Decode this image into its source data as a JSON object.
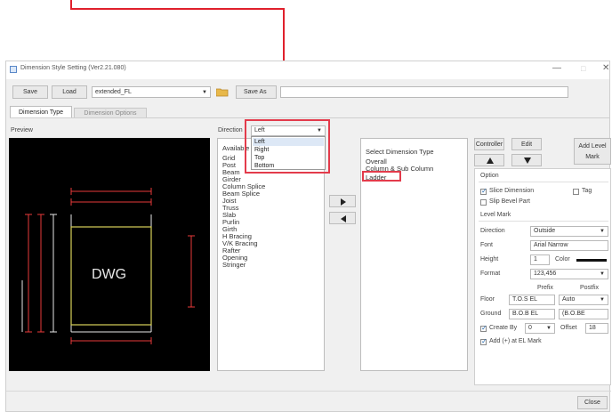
{
  "window": {
    "title": "Dimension Style Setting (Ver2.21.080)",
    "minimize_icon": "minimize-icon",
    "close_icon": "close-icon"
  },
  "toolbar": {
    "save_label": "Save",
    "load_label": "Load",
    "style_value": "extended_FL",
    "folder_icon": "folder-icon",
    "save_as_label": "Save As"
  },
  "tabs": [
    {
      "label": "Dimension Type"
    },
    {
      "label": "Dimension Options"
    }
  ],
  "preview": {
    "label": "Preview",
    "canvas_text": "DWG"
  },
  "direction": {
    "label": "Direction",
    "value": "Left",
    "options": [
      "Left",
      "Right",
      "Top",
      "Bottom"
    ]
  },
  "available": {
    "header": "Available",
    "items": [
      "Grid",
      "Post",
      "Beam",
      "Girder",
      "Column Splice",
      "Beam Splice",
      "Joist",
      "Truss",
      "Slab",
      "Purlin",
      "Girth",
      "H Bracing",
      "V/K Bracing",
      "Rafter",
      "Opening",
      "Stringer"
    ]
  },
  "transfer": {
    "add_icon": "triangle-right-icon",
    "remove_icon": "triangle-left-icon"
  },
  "selected": {
    "header": "Select Dimension Type",
    "items": [
      "Overall",
      "Column & Sub Column",
      "Ladder"
    ]
  },
  "right_panel": {
    "controller_label": "Controller",
    "edit_label": "Edit",
    "add_level_mark_label": "Add Level Mark",
    "up_icon": "triangle-up-icon",
    "down_icon": "triangle-down-icon",
    "option_title": "Option",
    "slice_dimension": {
      "label": "Slice Dimension",
      "checked": true
    },
    "tag": {
      "label": "Tag",
      "checked": false
    },
    "slip_bevel_part": {
      "label": "Slip Bevel Part",
      "checked": false
    },
    "level_mark_title": "Level Mark",
    "direction_label": "Direction",
    "direction_value": "Outside",
    "font_label": "Font",
    "font_value": "Arial Narrow",
    "height_label": "Height",
    "height_value": "1",
    "color_label": "Color",
    "format_label": "Format",
    "format_value": "123,456",
    "prefix_label": "Prefix",
    "postfix_label": "Postfix",
    "floor_label": "Floor",
    "floor_prefix": "T.O.S EL",
    "floor_postfix": "Auto",
    "ground_label": "Ground",
    "ground_prefix": "B.O.B EL",
    "ground_postfix": "(B.O.BE",
    "create_by_label": "Create By",
    "create_by_value": "0",
    "create_by_checked": true,
    "offset_label": "Offset",
    "offset_value": "18",
    "add_el_mark": {
      "label": "Add (+) at EL Mark",
      "checked": true
    }
  },
  "footer": {
    "close_label": "Close"
  },
  "colors": {
    "highlight": "#e33b4b",
    "arrow": "#e0202c",
    "canvas_bg": "#000000",
    "dwg_yellow": "#d8d25a",
    "dim_red": "#e83a3a",
    "dim_white": "#e8e8e8"
  }
}
